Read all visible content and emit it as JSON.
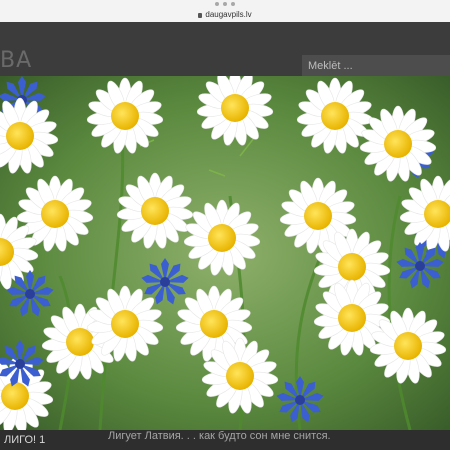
{
  "browser": {
    "url": "daugavpils.lv"
  },
  "header": {
    "logo_text": "BA",
    "search_placeholder": "Meklēt ..."
  },
  "hero": {
    "image_description_icon": "flowers-photo"
  },
  "caption": {
    "left_text": "ЛИГО! 1",
    "text": "Лигует Латвия. . . как будто сон мне снится."
  }
}
